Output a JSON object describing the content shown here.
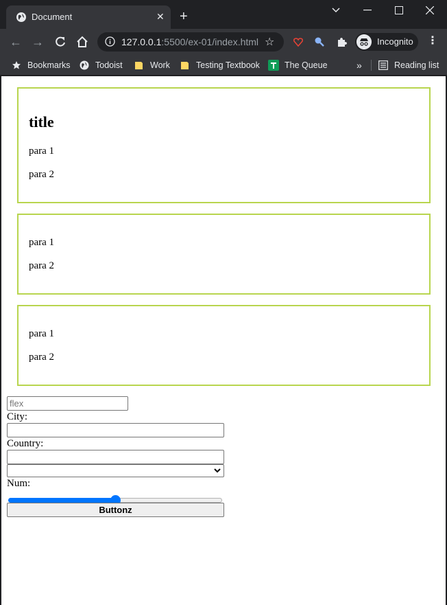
{
  "browser": {
    "tab_title": "Document",
    "url_host": "127.0.0.1",
    "url_rest": ":5500/ex-01/index.html",
    "profile_label": "Incognito",
    "bookmarks": [
      "Bookmarks",
      "Todoist",
      "Work",
      "Testing Textbook",
      "The Queue"
    ],
    "overflow_label": "»",
    "reading_list_label": "Reading list"
  },
  "cards": [
    {
      "title": "title",
      "paragraphs": [
        "para 1",
        "para 2"
      ]
    },
    {
      "paragraphs": [
        "para 1",
        "para 2"
      ]
    },
    {
      "paragraphs": [
        "para 1",
        "para 2"
      ]
    }
  ],
  "form": {
    "flex_placeholder": "flex",
    "city_label": "City:",
    "city_value": "",
    "country_label": "Country:",
    "country_value": "",
    "select_value": "",
    "num_label": "Num:",
    "num_value": 50,
    "button_label": "Buttonz"
  },
  "colors": {
    "card_border": "#b8d54e",
    "slider_accent": "#0075ff"
  }
}
